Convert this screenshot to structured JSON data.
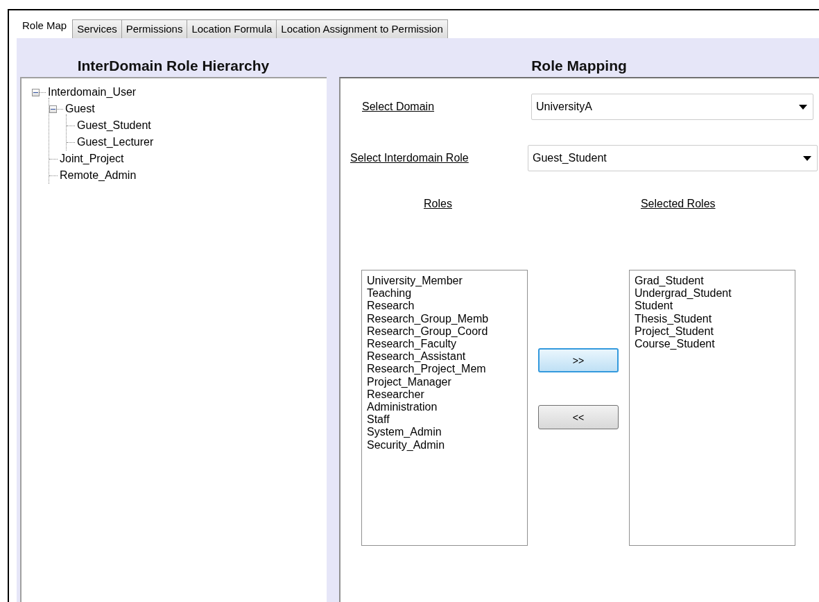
{
  "tabs": [
    {
      "label": "Role Map",
      "selected": true
    },
    {
      "label": "Services",
      "selected": false
    },
    {
      "label": "Permissions",
      "selected": false
    },
    {
      "label": "Location Formula",
      "selected": false
    },
    {
      "label": "Location Assignment to Permission",
      "selected": false
    }
  ],
  "hierarchy": {
    "title": "InterDomain Role Hierarchy",
    "tree": [
      {
        "label": "Interdomain_User",
        "expanded": true,
        "children": [
          {
            "label": "Guest",
            "expanded": true,
            "children": [
              {
                "label": "Guest_Student"
              },
              {
                "label": "Guest_Lecturer"
              }
            ]
          },
          {
            "label": "Joint_Project"
          },
          {
            "label": "Remote_Admin"
          }
        ]
      }
    ]
  },
  "mapping": {
    "title": "Role Mapping",
    "domain": {
      "label": "Select Domain",
      "value": "UniversityA"
    },
    "role": {
      "label": "Select Interdomain Role",
      "value": "Guest_Student"
    },
    "roles": {
      "heading": "Roles",
      "items": [
        "University_Member",
        "Teaching",
        "Research",
        "Research_Group_Memb",
        "Research_Group_Coord",
        "Research_Faculty",
        "Research_Assistant",
        "Research_Project_Mem",
        "Project_Manager",
        "Researcher",
        "Administration",
        "Staff",
        "System_Admin",
        "Security_Admin"
      ]
    },
    "selected_roles": {
      "heading": "Selected Roles",
      "items": [
        "Grad_Student",
        "Undergrad_Student",
        "Student",
        "Thesis_Student",
        "Project_Student",
        "Course_Student"
      ]
    },
    "buttons": [
      {
        "label": ">>",
        "focused": true
      },
      {
        "label": "<<",
        "focused": false
      }
    ]
  }
}
